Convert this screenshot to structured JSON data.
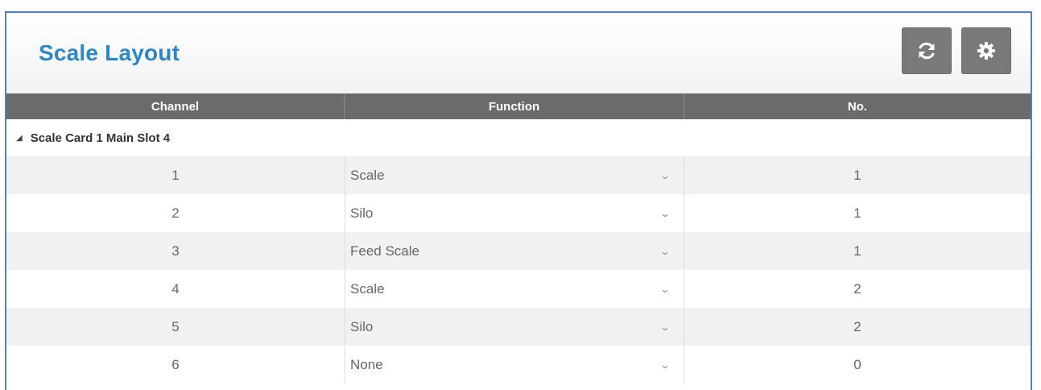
{
  "header": {
    "title": "Scale Layout",
    "buttons": {
      "refresh_icon": "refresh-icon",
      "settings_icon": "gear-icon"
    }
  },
  "table": {
    "columns": [
      "Channel",
      "Function",
      "No."
    ],
    "group_label": "Scale Card 1 Main Slot 4",
    "rows": [
      {
        "channel": "1",
        "function": "Scale",
        "no": "1"
      },
      {
        "channel": "2",
        "function": "Silo",
        "no": "1"
      },
      {
        "channel": "3",
        "function": "Feed Scale",
        "no": "1"
      },
      {
        "channel": "4",
        "function": "Scale",
        "no": "2"
      },
      {
        "channel": "5",
        "function": "Silo",
        "no": "2"
      },
      {
        "channel": "6",
        "function": "None",
        "no": "0"
      }
    ]
  },
  "colors": {
    "title": "#2c86c8",
    "header_bar": "#6b6b6b",
    "button": "#7a7a7a",
    "frame_border": "#4f7fc0"
  }
}
